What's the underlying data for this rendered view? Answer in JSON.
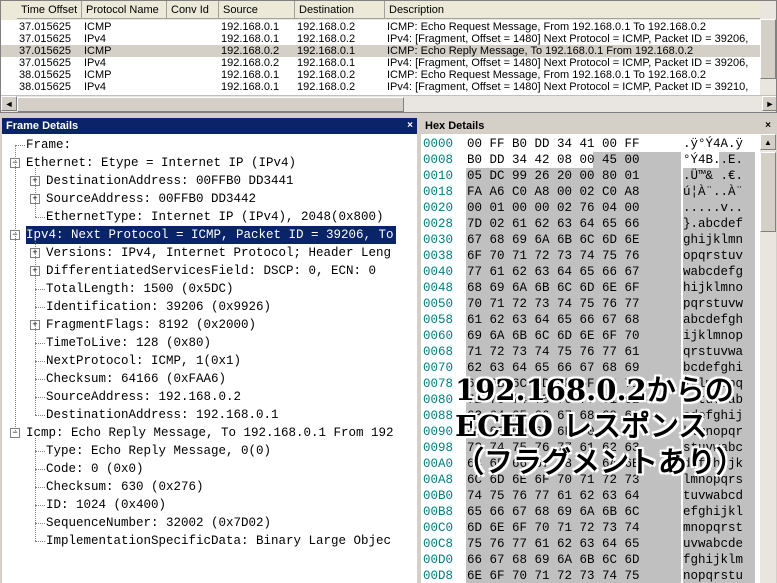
{
  "packet_list": {
    "columns": [
      "Time Offset",
      "Protocol Name",
      "Conv Id",
      "Source",
      "Destination",
      "Description"
    ],
    "rows": [
      [
        "37.015625",
        "ICMP",
        "",
        "192.168.0.1",
        "192.168.0.2",
        "ICMP: Echo Request Message, From 192.168.0.1 To 192.168.0.2"
      ],
      [
        "37.015625",
        "IPv4",
        "",
        "192.168.0.1",
        "192.168.0.2",
        "IPv4: [Fragment, Offset = 1480] Next Protocol = ICMP, Packet ID = 39206,"
      ],
      [
        "37.015625",
        "ICMP",
        "",
        "192.168.0.2",
        "192.168.0.1",
        "ICMP: Echo Reply Message, To 192.168.0.1 From 192.168.0.2"
      ],
      [
        "37.015625",
        "IPv4",
        "",
        "192.168.0.2",
        "192.168.0.1",
        "IPv4: [Fragment, Offset = 1480] Next Protocol = ICMP, Packet ID = 39206,"
      ],
      [
        "38.015625",
        "ICMP",
        "",
        "192.168.0.1",
        "192.168.0.2",
        "ICMP: Echo Request Message, From 192.168.0.1 To 192.168.0.2"
      ],
      [
        "38.015625",
        "IPv4",
        "",
        "192.168.0.1",
        "192.168.0.2",
        "IPv4: [Fragment, Offset = 1480] Next Protocol = ICMP, Packet ID = 39210,"
      ]
    ],
    "selected_row": 2
  },
  "frame_details": {
    "title": "Frame Details",
    "close": "×",
    "nodes": [
      {
        "text": "Frame:",
        "level": 0,
        "toggle": ""
      },
      {
        "text": "Ethernet: Etype = Internet IP (IPv4)",
        "level": 0,
        "toggle": "−"
      },
      {
        "text": "DestinationAddress: 00FFB0 DD3441",
        "level": 1,
        "toggle": "+"
      },
      {
        "text": "SourceAddress: 00FFB0 DD3442",
        "level": 1,
        "toggle": "+"
      },
      {
        "text": "EthernetType: Internet IP (IPv4), 2048(0x800)",
        "level": 1,
        "toggle": ""
      },
      {
        "text": "Ipv4: Next Protocol = ICMP, Packet ID = 39206, To",
        "level": 0,
        "toggle": "−",
        "selected": true
      },
      {
        "text": "Versions: IPv4, Internet Protocol; Header Leng",
        "level": 1,
        "toggle": "+"
      },
      {
        "text": "DifferentiatedServicesField: DSCP: 0, ECN: 0",
        "level": 1,
        "toggle": "+"
      },
      {
        "text": "TotalLength: 1500 (0x5DC)",
        "level": 1,
        "toggle": ""
      },
      {
        "text": "Identification: 39206 (0x9926)",
        "level": 1,
        "toggle": ""
      },
      {
        "text": "FragmentFlags: 8192 (0x2000)",
        "level": 1,
        "toggle": "+"
      },
      {
        "text": "TimeToLive: 128 (0x80)",
        "level": 1,
        "toggle": ""
      },
      {
        "text": "NextProtocol: ICMP, 1(0x1)",
        "level": 1,
        "toggle": ""
      },
      {
        "text": "Checksum: 64166 (0xFAA6)",
        "level": 1,
        "toggle": ""
      },
      {
        "text": "SourceAddress: 192.168.0.2",
        "level": 1,
        "toggle": ""
      },
      {
        "text": "DestinationAddress: 192.168.0.1",
        "level": 1,
        "toggle": ""
      },
      {
        "text": "Icmp: Echo Reply Message, To 192.168.0.1 From 192",
        "level": 0,
        "toggle": "−"
      },
      {
        "text": "Type: Echo Reply Message, 0(0)",
        "level": 1,
        "toggle": ""
      },
      {
        "text": "Code: 0 (0x0)",
        "level": 1,
        "toggle": ""
      },
      {
        "text": "Checksum: 630 (0x276)",
        "level": 1,
        "toggle": ""
      },
      {
        "text": "ID: 1024 (0x400)",
        "level": 1,
        "toggle": ""
      },
      {
        "text": "SequenceNumber: 32002 (0x7D02)",
        "level": 1,
        "toggle": ""
      },
      {
        "text": "ImplementationSpecificData: Binary Large Objec",
        "level": 1,
        "toggle": ""
      }
    ]
  },
  "hex_details": {
    "title": "Hex Details",
    "close": "×",
    "rows": [
      {
        "offset": "0000",
        "bytes": "00 FF B0 DD 34 41 00 FF",
        "ascii": ".ÿ°Ý4A.ÿ"
      },
      {
        "offset": "0008",
        "bytes": "B0 DD 34 42 08 00 45 00",
        "ascii": "°Ý4B..E."
      },
      {
        "offset": "0010",
        "bytes": "05 DC 99 26 20 00 80 01",
        "ascii": ".Ü™& .€."
      },
      {
        "offset": "0018",
        "bytes": "FA A6 C0 A8 00 02 C0 A8",
        "ascii": "ú¦À¨..À¨"
      },
      {
        "offset": "0020",
        "bytes": "00 01 00 00 02 76 04 00",
        "ascii": ".....v.."
      },
      {
        "offset": "0028",
        "bytes": "7D 02 61 62 63 64 65 66",
        "ascii": "}.abcdef"
      },
      {
        "offset": "0030",
        "bytes": "67 68 69 6A 6B 6C 6D 6E",
        "ascii": "ghijklmn"
      },
      {
        "offset": "0038",
        "bytes": "6F 70 71 72 73 74 75 76",
        "ascii": "opqrstuv"
      },
      {
        "offset": "0040",
        "bytes": "77 61 62 63 64 65 66 67",
        "ascii": "wabcdefg"
      },
      {
        "offset": "0048",
        "bytes": "68 69 6A 6B 6C 6D 6E 6F",
        "ascii": "hijklmno"
      },
      {
        "offset": "0050",
        "bytes": "70 71 72 73 74 75 76 77",
        "ascii": "pqrstuvw"
      },
      {
        "offset": "0058",
        "bytes": "61 62 63 64 65 66 67 68",
        "ascii": "abcdefgh"
      },
      {
        "offset": "0060",
        "bytes": "69 6A 6B 6C 6D 6E 6F 70",
        "ascii": "ijklmnop"
      },
      {
        "offset": "0068",
        "bytes": "71 72 73 74 75 76 77 61",
        "ascii": "qrstuvwa"
      },
      {
        "offset": "0070",
        "bytes": "62 63 64 65 66 67 68 69",
        "ascii": "bcdefghi"
      },
      {
        "offset": "0078",
        "bytes": "6A 6B 6C 6D 6E 6F 70 71",
        "ascii": "jklmnopq"
      },
      {
        "offset": "0080",
        "bytes": "72 73 74 75 76 77 61 62",
        "ascii": "rstuvwab"
      },
      {
        "offset": "0088",
        "bytes": "63 64 65 66 67 68 69 6A",
        "ascii": "cdefghij"
      },
      {
        "offset": "0090",
        "bytes": "6B 6C 6D 6E 6F 70 71 72",
        "ascii": "klmnopqr"
      },
      {
        "offset": "0098",
        "bytes": "73 74 75 76 77 61 62 63",
        "ascii": "stuvwabc"
      },
      {
        "offset": "00A0",
        "bytes": "64 65 66 67 68 69 6A 6B",
        "ascii": "defghijk"
      },
      {
        "offset": "00A8",
        "bytes": "6C 6D 6E 6F 70 71 72 73",
        "ascii": "lmnopqrs"
      },
      {
        "offset": "00B0",
        "bytes": "74 75 76 77 61 62 63 64",
        "ascii": "tuvwabcd"
      },
      {
        "offset": "00B8",
        "bytes": "65 66 67 68 69 6A 6B 6C",
        "ascii": "efghijkl"
      },
      {
        "offset": "00C0",
        "bytes": "6D 6E 6F 70 71 72 73 74",
        "ascii": "mnopqrst"
      },
      {
        "offset": "00C8",
        "bytes": "75 76 77 61 62 63 64 65",
        "ascii": "uvwabcde"
      },
      {
        "offset": "00D0",
        "bytes": "66 67 68 69 6A 6B 6C 6D",
        "ascii": "fghijklm"
      },
      {
        "offset": "00D8",
        "bytes": "6E 6F 70 71 72 73 74 75",
        "ascii": "nopqrstu"
      }
    ]
  },
  "caption": {
    "lines": [
      "192.168.0.2からの",
      "ECHO レスポンス",
      "（フラグメントあり）"
    ]
  },
  "colors": {
    "selection": "#0a246a",
    "offset_text": "#008080",
    "highlight": "#c0c0c0"
  }
}
